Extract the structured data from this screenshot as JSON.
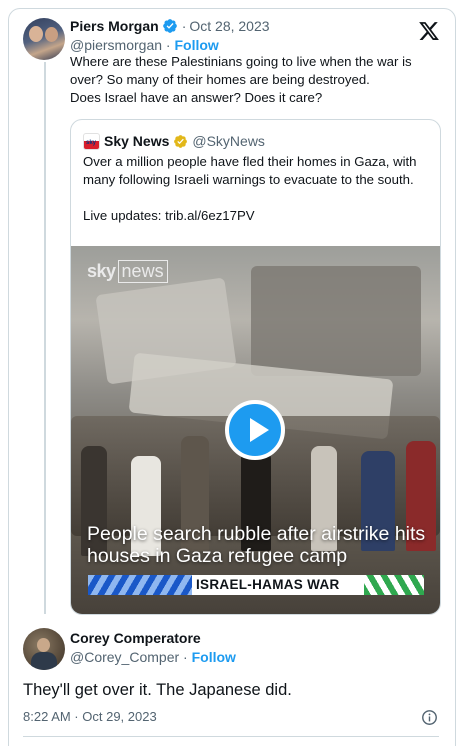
{
  "tweet": {
    "author_name": "Piers Morgan",
    "dot": "·",
    "date": "Oct 28, 2023",
    "handle": "@piersmorgan",
    "follow_label": "Follow",
    "text_lines": [
      "Where are these Palestinians going to live when the war is",
      "over? So many of their homes are being destroyed.",
      "Does Israel have an answer? Does it care?"
    ]
  },
  "quote": {
    "author_name": "Sky News",
    "handle": "@SkyNews",
    "text_lines": [
      "Over a million people have fled their homes in Gaza, with",
      "many following Israeli warnings to evacuate to the south.",
      "",
      "Live updates: trib.al/6ez17PV"
    ],
    "video": {
      "watermark_sky": "sky",
      "watermark_news": "news",
      "caption_lines": [
        "People search rubble after airstrike hits",
        "houses in Gaza refugee camp"
      ],
      "banner_text": "ISRAEL-HAMAS WAR"
    }
  },
  "reply": {
    "author_name": "Corey Comperatore",
    "handle": "@Corey_Comper",
    "follow_label": "Follow",
    "text": "They'll get over it. The Japanese did.",
    "timestamp": "8:22 AM · Oct 29, 2023"
  },
  "icons": {
    "verified": "verified-badge-icon",
    "gold_verified": "gold-verified-badge-icon",
    "x_logo": "x-logo-icon",
    "play": "play-icon",
    "info": "info-icon"
  },
  "colors": {
    "accent": "#1d9bf0",
    "text": "#0f1419",
    "secondary": "#536471",
    "border": "#cfd9de",
    "gold": "#e2b719"
  }
}
